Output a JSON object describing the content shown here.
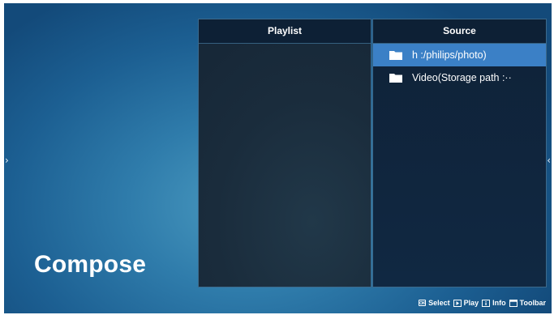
{
  "screen_title": "Compose",
  "nav": {
    "left_arrow": "›",
    "right_arrow": "‹"
  },
  "playlist": {
    "header": "Playlist",
    "items": []
  },
  "source": {
    "header": "Source",
    "items": [
      {
        "label": "h :/philips/photo)",
        "icon": "folder-icon",
        "selected": true
      },
      {
        "label": "Video(Storage path :··",
        "icon": "folder-icon",
        "selected": false
      }
    ]
  },
  "hints": [
    {
      "key_icon": "OK",
      "label": "Select"
    },
    {
      "key_icon": "play-icon",
      "label": "Play"
    },
    {
      "key_icon": "info-icon",
      "label": "Info"
    },
    {
      "key_icon": "toolbar-icon",
      "label": "Toolbar"
    }
  ],
  "colors": {
    "background_gradient_center": "#4a9ac0",
    "background_gradient_edge": "#134a7a",
    "selected_row": "#3b80c6",
    "panel_header": "#0d2035"
  }
}
